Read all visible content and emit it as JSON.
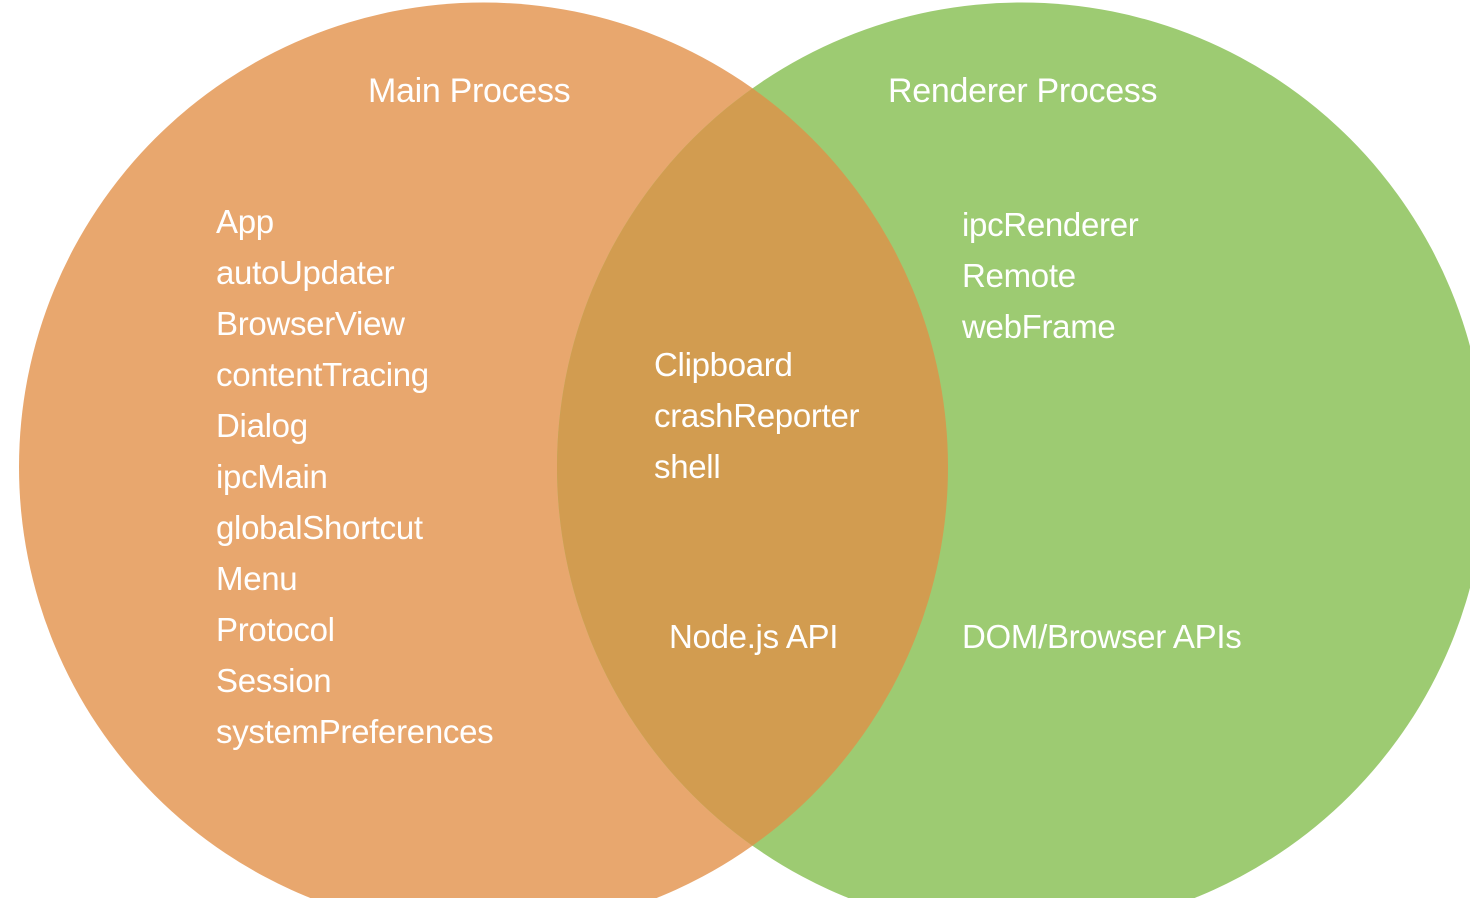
{
  "colors": {
    "main": "#E8A76E",
    "renderer": "#9DCB72",
    "overlap": "#D29C50",
    "text": "#FFFFFF"
  },
  "main_process": {
    "title": "Main Process",
    "modules": [
      "App",
      "autoUpdater",
      "BrowserView",
      "contentTracing",
      "Dialog",
      "ipcMain",
      "globalShortcut",
      "Menu",
      "Protocol",
      "Session",
      "systemPreferences"
    ]
  },
  "shared": {
    "modules": [
      "Clipboard",
      "crashReporter",
      "shell"
    ],
    "api": "Node.js API"
  },
  "renderer_process": {
    "title": "Renderer Process",
    "modules": [
      "ipcRenderer",
      "Remote",
      "webFrame"
    ],
    "api": "DOM/Browser APIs"
  }
}
